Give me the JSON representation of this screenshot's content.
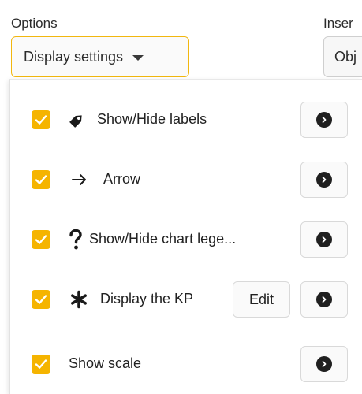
{
  "toolbar": {
    "options_label": "Options",
    "insert_label": "Inser",
    "display_settings_label": "Display settings",
    "insert_button_label": "Obj"
  },
  "menu": {
    "items": [
      {
        "label": "Show/Hide labels",
        "checked": true,
        "icon": "tag-icon"
      },
      {
        "label": "Arrow",
        "checked": true,
        "icon": "arrow-right-icon"
      },
      {
        "label": "Show/Hide chart lege...",
        "checked": true,
        "icon": "question-mark-icon"
      },
      {
        "label": "Display the KP",
        "checked": true,
        "icon": "asterisk-icon",
        "edit_label": "Edit"
      },
      {
        "label": "Show scale",
        "checked": true,
        "icon": ""
      }
    ]
  },
  "colors": {
    "accent": "#f5b400",
    "dropdown_border": "#f2b70f",
    "go_button_circle": "#202020"
  }
}
